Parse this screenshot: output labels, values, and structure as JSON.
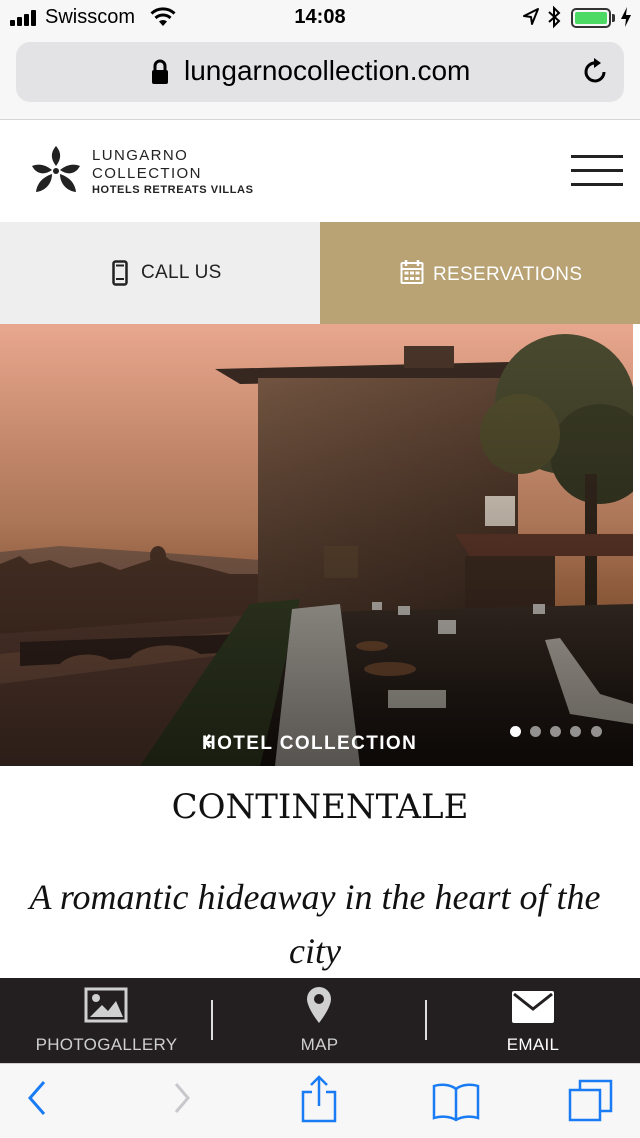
{
  "status_bar": {
    "carrier": "Swisscom",
    "time": "14:08",
    "battery_level": 1.0
  },
  "browser": {
    "url": "lungarnocollection.com"
  },
  "header": {
    "logo_line1": "LUNGARNO",
    "logo_line2": "COLLECTION",
    "logo_line3": "HOTELS RETREATS VILLAS"
  },
  "actions": {
    "call_label": "CALL US",
    "reservations_label": "RESERVATIONS",
    "reservations_color": "#b9a273"
  },
  "hero": {
    "link_label": "HOTEL COLLECTION",
    "slide_count": 5,
    "active_slide": 1
  },
  "content": {
    "hotel_name": "CONTINENTALE",
    "tagline": "A romantic hideaway in the heart of the city"
  },
  "bottom_bar": {
    "photogallery_label": "PHOTOGALLERY",
    "map_label": "MAP",
    "email_label": "EMAIL"
  },
  "icons": [
    "signal-icon",
    "wifi-icon",
    "location-icon",
    "bluetooth-icon",
    "battery-icon",
    "lock-icon",
    "reload-icon",
    "logo-icon",
    "menu-icon",
    "phone-icon",
    "calendar-icon",
    "chevron-left-icon",
    "image-icon",
    "map-pin-icon",
    "envelope-icon",
    "back-icon",
    "forward-icon",
    "share-icon",
    "bookmarks-icon",
    "tabs-icon"
  ],
  "colors": {
    "accent": "#b9a273",
    "dark_bar": "#231f20",
    "ios_blue": "#1a7cf5"
  }
}
